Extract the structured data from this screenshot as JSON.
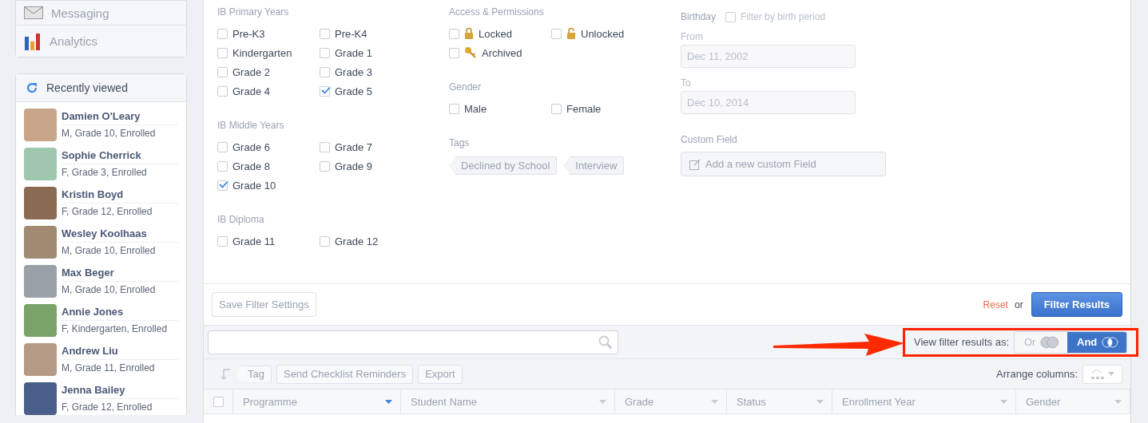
{
  "nav": [
    {
      "label": "Messaging",
      "kind": "envelope"
    },
    {
      "label": "Analytics",
      "kind": "chart"
    }
  ],
  "recently_viewed": {
    "title": "Recently viewed",
    "people": [
      {
        "name": "Damien O'Leary",
        "details": "M, Grade 10, Enrolled"
      },
      {
        "name": "Sophie Cherrick",
        "details": "F, Grade 3, Enrolled"
      },
      {
        "name": "Kristin Boyd",
        "details": "F, Grade 12, Enrolled"
      },
      {
        "name": "Wesley Koolhaas",
        "details": "M, Grade 10, Enrolled"
      },
      {
        "name": "Max Beger",
        "details": "M, Grade 10, Enrolled"
      },
      {
        "name": "Annie Jones",
        "details": "F, Kindergarten, Enrolled"
      },
      {
        "name": "Andrew Liu",
        "details": "M, Grade 11, Enrolled"
      },
      {
        "name": "Jenna Bailey",
        "details": "F, Grade 12, Enrolled"
      }
    ]
  },
  "programmes": [
    {
      "title": "IB Primary Years",
      "options": [
        {
          "label": "Pre-K3",
          "checked": false
        },
        {
          "label": "Pre-K4",
          "checked": false
        },
        {
          "label": "Kindergarten",
          "checked": false
        },
        {
          "label": "Grade 1",
          "checked": false
        },
        {
          "label": "Grade 2",
          "checked": false
        },
        {
          "label": "Grade 3",
          "checked": false
        },
        {
          "label": "Grade 4",
          "checked": false
        },
        {
          "label": "Grade 5",
          "checked": true
        }
      ]
    },
    {
      "title": "IB Middle Years",
      "options": [
        {
          "label": "Grade 6",
          "checked": false
        },
        {
          "label": "Grade 7",
          "checked": false
        },
        {
          "label": "Grade 8",
          "checked": false
        },
        {
          "label": "Grade 9",
          "checked": false
        },
        {
          "label": "Grade 10",
          "checked": true
        }
      ]
    },
    {
      "title": "IB Diploma",
      "options": [
        {
          "label": "Grade 11",
          "checked": false
        },
        {
          "label": "Grade 12",
          "checked": false
        }
      ]
    }
  ],
  "access": {
    "title": "Access & Permissions",
    "options": [
      {
        "label": "Locked",
        "kind": "locked",
        "checked": false
      },
      {
        "label": "Unlocked",
        "kind": "unlocked",
        "checked": false
      },
      {
        "label": "Archived",
        "kind": "key",
        "checked": false
      }
    ]
  },
  "gender": {
    "title": "Gender",
    "options": [
      {
        "label": "Male",
        "checked": false
      },
      {
        "label": "Female",
        "checked": false
      }
    ]
  },
  "tags": {
    "title": "Tags",
    "items": [
      "Declined by School",
      "Interview"
    ]
  },
  "birthday": {
    "title": "Birthday",
    "filter_option": {
      "label": "Filter by birth period",
      "checked": false
    },
    "from": {
      "label": "From",
      "value": "Dec 11, 2002",
      "disabled": true
    },
    "to": {
      "label": "To",
      "value": "Dec 10, 2014",
      "disabled": true
    }
  },
  "custom_field": {
    "title": "Custom Field",
    "button": "Add a new custom Field"
  },
  "actions": {
    "save": "Save Filter Settings",
    "reset": "Reset",
    "or": "or",
    "submit": "Filter Results"
  },
  "view_mode": {
    "label": "View filter results as:",
    "options": [
      {
        "label": "Or",
        "selected": false
      },
      {
        "label": "And",
        "selected": true
      }
    ]
  },
  "toolbar": {
    "buttons": [
      {
        "label": "Tag",
        "kind": "tag"
      },
      {
        "label": "Send Checklist Reminders",
        "kind": "plain"
      },
      {
        "label": "Export",
        "kind": "plain"
      }
    ],
    "arrange_label": "Arrange columns:"
  },
  "table": {
    "select_all": {
      "checked": false
    },
    "columns": [
      {
        "label": "Programme",
        "sorted": true
      },
      {
        "label": "Student Name",
        "sorted": false
      },
      {
        "label": "Grade",
        "sorted": false
      },
      {
        "label": "Status",
        "sorted": false
      },
      {
        "label": "Enrollment Year",
        "sorted": false
      },
      {
        "label": "Gender",
        "sorted": false
      }
    ]
  }
}
